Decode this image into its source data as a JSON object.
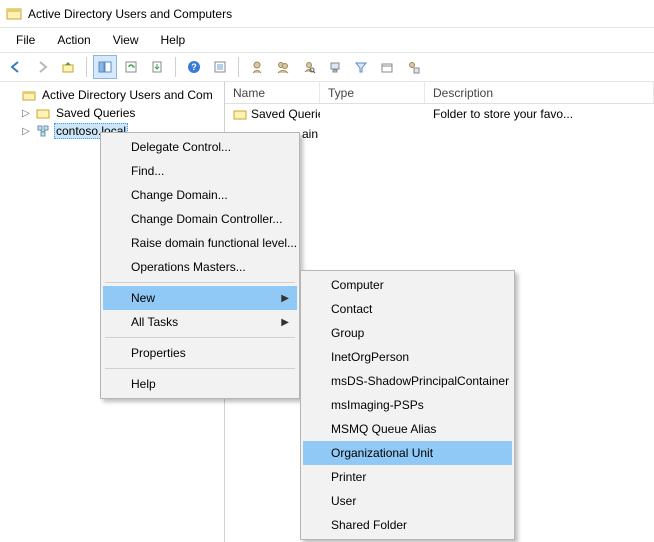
{
  "window": {
    "title": "Active Directory Users and Computers"
  },
  "menubar": {
    "items": [
      "File",
      "Action",
      "View",
      "Help"
    ]
  },
  "toolbar": {
    "buttons": [
      "back-icon",
      "forward-icon",
      "up-icon",
      "show-hide-tree-icon",
      "refresh-icon",
      "export-list-icon",
      "help-icon",
      "properties-icon",
      "add-user-icon",
      "add-group-icon",
      "find-icon",
      "add-computer-icon",
      "filter-icon",
      "container-icon",
      "misc-icon"
    ],
    "separators_after": [
      2,
      5,
      7
    ]
  },
  "tree": {
    "root": {
      "label": "Active Directory Users and Com"
    },
    "children": [
      {
        "label": "Saved Queries",
        "icon": "folder-icon",
        "expandable": true
      },
      {
        "label": "contoso.local",
        "icon": "domain-icon",
        "expandable": true,
        "selected": true
      }
    ]
  },
  "list": {
    "columns": [
      "Name",
      "Type",
      "Description"
    ],
    "rows": [
      {
        "name": "Saved Queries",
        "type": "",
        "description": "Folder to store your favo...",
        "icon": "folder-icon"
      },
      {
        "name_fragment": "ain",
        "type": "",
        "description": "",
        "icon": "domain-icon"
      }
    ]
  },
  "context_menu_main": {
    "groups": [
      [
        "Delegate Control...",
        "Find...",
        "Change Domain...",
        "Change Domain Controller...",
        "Raise domain functional level...",
        "Operations Masters..."
      ],
      [
        "New",
        "All Tasks"
      ],
      [
        "Properties"
      ],
      [
        "Help"
      ]
    ],
    "submenu_items": {
      "New": true,
      "All Tasks": true
    },
    "highlighted": "New"
  },
  "context_menu_new": {
    "items": [
      "Computer",
      "Contact",
      "Group",
      "InetOrgPerson",
      "msDS-ShadowPrincipalContainer",
      "msImaging-PSPs",
      "MSMQ Queue Alias",
      "Organizational Unit",
      "Printer",
      "User",
      "Shared Folder"
    ],
    "highlighted": "Organizational Unit"
  }
}
